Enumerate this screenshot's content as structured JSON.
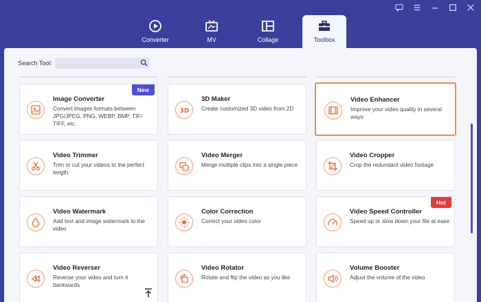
{
  "nav": {
    "tabs": [
      {
        "label": "Converter",
        "icon": "converter-icon"
      },
      {
        "label": "MV",
        "icon": "tv-icon"
      },
      {
        "label": "Collage",
        "icon": "collage-icon"
      },
      {
        "label": "Toolbox",
        "icon": "toolbox-icon",
        "active": true
      }
    ]
  },
  "search": {
    "label": "Search Tool:",
    "value": "",
    "placeholder": ""
  },
  "tools": [
    {
      "title": "Image Converter",
      "desc": "Convert images formats between JPG/JPEG, PNG, WEBP, BMP, TIF/ TIFF, etc.",
      "badge": "New",
      "icon": "image-icon"
    },
    {
      "title": "3D Maker",
      "desc": "Create customized 3D video from 2D",
      "icon": "3d-icon"
    },
    {
      "title": "Video Enhancer",
      "desc": "Improve your video quality in several ways",
      "icon": "film-icon",
      "selected": true
    },
    {
      "title": "Video Trimmer",
      "desc": "Trim or cut your videos to the perfect length",
      "icon": "scissors-icon"
    },
    {
      "title": "Video Merger",
      "desc": "Merge multiple clips into a single piece",
      "icon": "merge-icon"
    },
    {
      "title": "Video Cropper",
      "desc": "Crop the redundant video footage",
      "icon": "crop-icon"
    },
    {
      "title": "Video Watermark",
      "desc": "Add text and image watermark to the video",
      "icon": "drop-icon"
    },
    {
      "title": "Color Correction",
      "desc": "Correct your video color",
      "icon": "sun-icon"
    },
    {
      "title": "Video Speed Controller",
      "desc": "Speed up or slow down your file at ease",
      "badge": "Hot",
      "icon": "speedometer-icon"
    },
    {
      "title": "Video Reverser",
      "desc": "Reverse your video and turn it backwards",
      "icon": "rewind-icon"
    },
    {
      "title": "Video Rotator",
      "desc": "Rotate and flip the video as you like",
      "icon": "rotate-icon"
    },
    {
      "title": "Volume Booster",
      "desc": "Adjust the volume of the video",
      "icon": "speaker-icon"
    }
  ],
  "colors": {
    "accent": "#f08a3a",
    "brand": "#3b3f9c",
    "new_badge": "#4b4fd8",
    "hot_badge": "#e63a3a"
  }
}
